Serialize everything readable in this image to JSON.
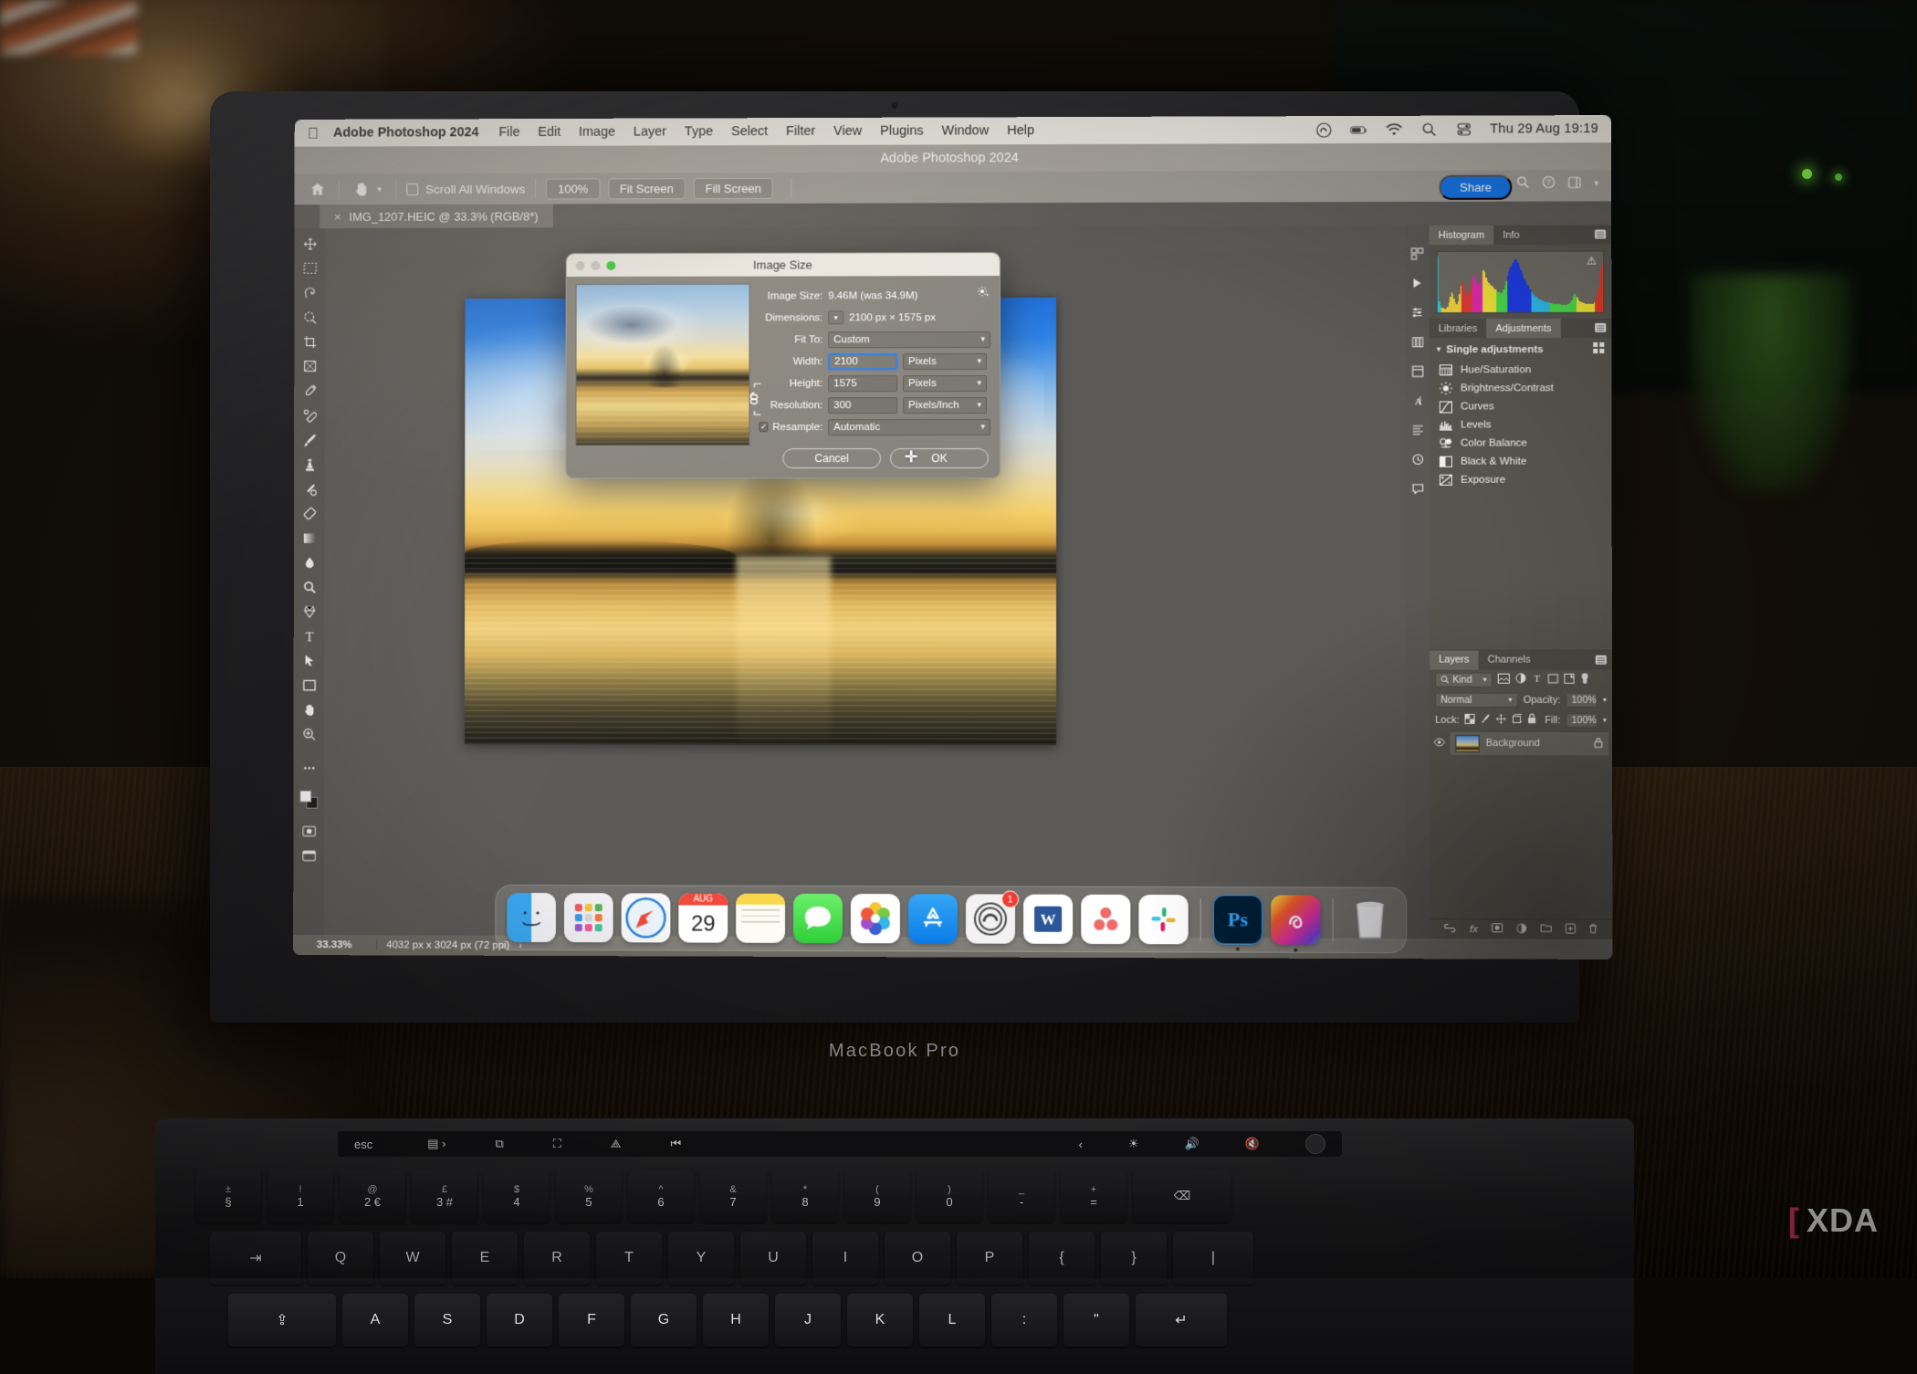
{
  "menubar": {
    "apple_icon": "apple-icon",
    "app_name": "Adobe Photoshop 2024",
    "items": [
      "File",
      "Edit",
      "Image",
      "Layer",
      "Type",
      "Select",
      "Filter",
      "View",
      "Plugins",
      "Window",
      "Help"
    ],
    "right_icons": [
      "creative-cloud-icon",
      "battery-icon",
      "wifi-icon",
      "search-icon",
      "control-center-icon"
    ],
    "clock": "Thu 29 Aug  19:19"
  },
  "ps_window": {
    "title": "Adobe Photoshop 2024",
    "options_bar": {
      "home_icon": "home-icon",
      "tool_icon": "hand-tool-icon",
      "tool_caret": "chevron-down-icon",
      "scroll_all_windows": "Scroll All Windows",
      "zoom_100": "100%",
      "fit_screen": "Fit Screen",
      "fill_screen": "Fill Screen",
      "share": "Share",
      "right_icons": [
        "search-icon",
        "help-icon",
        "workspace-icon",
        "chevron-down-icon"
      ]
    },
    "tab": {
      "close_icon": "close-icon",
      "label": "IMG_1207.HEIC @ 33.3% (RGB/8*)"
    },
    "statusbar": {
      "zoom": "33.33%",
      "dimensions": "4032 px x 3024 px (72 ppi)",
      "expand_icon": "chevron-right-icon"
    }
  },
  "toolbar": {
    "tools": [
      "move-tool",
      "marquee-tool",
      "lasso-tool",
      "object-select-tool",
      "crop-tool",
      "frame-tool",
      "eyedropper-tool",
      "healing-brush-tool",
      "brush-tool",
      "clone-stamp-tool",
      "history-brush-tool",
      "eraser-tool",
      "gradient-tool",
      "blur-tool",
      "dodge-tool",
      "pen-tool",
      "type-tool",
      "path-select-tool",
      "shape-tool",
      "hand-tool",
      "zoom-tool",
      "edit-toolbar"
    ],
    "foreground_color": "#f2f2f2",
    "background_color": "#1e1e1e",
    "quick_mask": "quick-mask-icon",
    "screen_mode": "screen-mode-icon"
  },
  "panels": {
    "rail_icons": [
      "presets-icon",
      "play-icon",
      "adjustments-icon",
      "libraries-icon",
      "properties-icon",
      "character-icon",
      "paragraph-icon",
      "history-icon",
      "comments-icon"
    ],
    "top_tabs": [
      {
        "label": "Histogram",
        "active": true
      },
      {
        "label": "Info",
        "active": false
      }
    ],
    "histogram_warning": "warning-icon",
    "mid_tabs": [
      {
        "label": "Libraries",
        "active": false
      },
      {
        "label": "Adjustments",
        "active": true
      }
    ],
    "adjustments_heading": "Single adjustments",
    "adjustments_grid_icon": "grid-view-icon",
    "adjustments": [
      {
        "label": "Hue/Saturation",
        "icon": "hue-saturation-icon"
      },
      {
        "label": "Brightness/Contrast",
        "icon": "brightness-contrast-icon"
      },
      {
        "label": "Curves",
        "icon": "curves-icon"
      },
      {
        "label": "Levels",
        "icon": "levels-icon"
      },
      {
        "label": "Color Balance",
        "icon": "color-balance-icon"
      },
      {
        "label": "Black & White",
        "icon": "black-white-icon"
      },
      {
        "label": "Exposure",
        "icon": "exposure-icon"
      }
    ],
    "layers_tabs": [
      {
        "label": "Layers",
        "active": true
      },
      {
        "label": "Channels",
        "active": false
      }
    ],
    "filter_kind": "Kind",
    "filter_icons": [
      "pixel-filter-icon",
      "adjustment-filter-icon",
      "type-filter-icon",
      "shape-filter-icon",
      "smart-object-filter-icon",
      "filter-toggle-icon"
    ],
    "blend_mode": "Normal",
    "opacity_label": "Opacity:",
    "opacity_value": "100%",
    "lock_label": "Lock:",
    "lock_icons": [
      "lock-transparent-icon",
      "lock-image-icon",
      "lock-position-icon",
      "lock-artboard-icon",
      "lock-all-icon"
    ],
    "fill_label": "Fill:",
    "fill_value": "100%",
    "layers": [
      {
        "name": "Background",
        "visible_icon": "eye-icon",
        "lock_icon": "lock-icon"
      }
    ],
    "layers_footer_icons": [
      "link-layers-icon",
      "layer-style-icon",
      "layer-mask-icon",
      "adjustment-layer-icon",
      "new-group-icon",
      "new-layer-icon",
      "delete-layer-icon"
    ]
  },
  "dialog": {
    "title": "Image Size",
    "traffic_lights": [
      "close-button",
      "minimize-button",
      "zoom-button"
    ],
    "gear_icon": "gear-icon",
    "chain_icon": "link-constrain-icon",
    "image_size_label": "Image Size:",
    "image_size_value": "9.46M (was 34.9M)",
    "dimensions_label": "Dimensions:",
    "dimensions_value": "2100 px  ×  1575 px",
    "dimensions_caret": "chevron-down-icon",
    "fit_to_label": "Fit To:",
    "fit_to_value": "Custom",
    "width_label": "Width:",
    "width_value": "2100",
    "width_unit": "Pixels",
    "height_label": "Height:",
    "height_value": "1575",
    "height_unit": "Pixels",
    "resolution_label": "Resolution:",
    "resolution_value": "300",
    "resolution_unit": "Pixels/Inch",
    "resample_label": "Resample:",
    "resample_value": "Automatic",
    "resample_checked": "✓",
    "cancel": "Cancel",
    "ok": "OK",
    "cursor_icon": "move-cursor-icon"
  },
  "dock": {
    "items": [
      {
        "name": "finder",
        "label": "Finder",
        "bg": "#2196f3",
        "glyph": "☺",
        "running": false
      },
      {
        "name": "launchpad",
        "label": "Launchpad",
        "bg": "#f0f0f2",
        "glyph": "",
        "running": false
      },
      {
        "name": "safari",
        "label": "Safari",
        "bg": "#f4f4f6",
        "glyph": "🧭",
        "running": false
      },
      {
        "name": "calendar",
        "label": "Calendar",
        "bg": "#ffffff",
        "glyph": "29",
        "sub": "AUG",
        "running": false
      },
      {
        "name": "notes",
        "label": "Notes",
        "bg": "#fdfbf3",
        "glyph": "",
        "running": false
      },
      {
        "name": "messages",
        "label": "Messages",
        "bg": "#55d95a",
        "glyph": "💬",
        "running": false
      },
      {
        "name": "photos",
        "label": "Photos",
        "bg": "#ffffff",
        "glyph": "✿",
        "running": false
      },
      {
        "name": "app-store",
        "label": "App Store",
        "bg": "#1b8cf5",
        "glyph": "A",
        "running": false
      },
      {
        "name": "creative-cloud-desktop",
        "label": "Creative Cloud",
        "bg": "#f2f2f2",
        "glyph": "◎",
        "badge": "1",
        "running": false
      },
      {
        "name": "microsoft-word",
        "label": "Microsoft Word",
        "bg": "#ffffff",
        "glyph": "W",
        "running": false
      },
      {
        "name": "asana",
        "label": "Asana",
        "bg": "#ffffff",
        "glyph": "⁘",
        "running": false
      },
      {
        "name": "slack",
        "label": "Slack",
        "bg": "#ffffff",
        "glyph": "✳",
        "running": false
      },
      {
        "name": "photoshop",
        "label": "Adobe Photoshop",
        "bg": "#001e36",
        "glyph": "Ps",
        "running": true
      },
      {
        "name": "creative-cloud",
        "label": "Creative Cloud",
        "bg": "#e8307a",
        "glyph": "∞",
        "running": true
      },
      {
        "name": "trash",
        "label": "Trash",
        "bg": "#f4f4f6",
        "glyph": "🗑",
        "running": false
      }
    ]
  },
  "laptop": {
    "model_label": "MacBook Pro"
  },
  "touchbar": {
    "esc": "esc",
    "icons": [
      "mission-control-icon",
      "screenshot-icon",
      "airplay-icon",
      "previous-track-icon"
    ],
    "right_icons": [
      "rewind-icon",
      "brightness-icon",
      "volume-icon",
      "mute-icon",
      "touch-id-icon"
    ]
  },
  "keyboard": {
    "row_numbers": [
      {
        "top": "±",
        "bottom": "§"
      },
      {
        "top": "!",
        "bottom": "1"
      },
      {
        "top": "@",
        "bottom": "2 €"
      },
      {
        "top": "£",
        "bottom": "3 #"
      },
      {
        "top": "$",
        "bottom": "4"
      },
      {
        "top": "%",
        "bottom": "5"
      },
      {
        "top": "^",
        "bottom": "6"
      },
      {
        "top": "&",
        "bottom": "7"
      },
      {
        "top": "*",
        "bottom": "8"
      },
      {
        "top": "(",
        "bottom": "9"
      },
      {
        "top": ")",
        "bottom": "0"
      },
      {
        "top": "_",
        "bottom": "-"
      },
      {
        "top": "+",
        "bottom": "="
      },
      {
        "top": "",
        "bottom": "⌫"
      }
    ],
    "row_qwerty": [
      "⇥",
      "Q",
      "W",
      "E",
      "R",
      "T",
      "Y",
      "U",
      "I",
      "O",
      "P",
      "{",
      "}",
      "|"
    ],
    "row_home": [
      "⇪",
      "A",
      "S",
      "D",
      "F",
      "G",
      "H",
      "J",
      "K",
      "L",
      ":",
      "\"",
      "↵"
    ]
  },
  "watermark": {
    "bracket_left": "[",
    "text": "XDA",
    "bracket_right": "]"
  }
}
